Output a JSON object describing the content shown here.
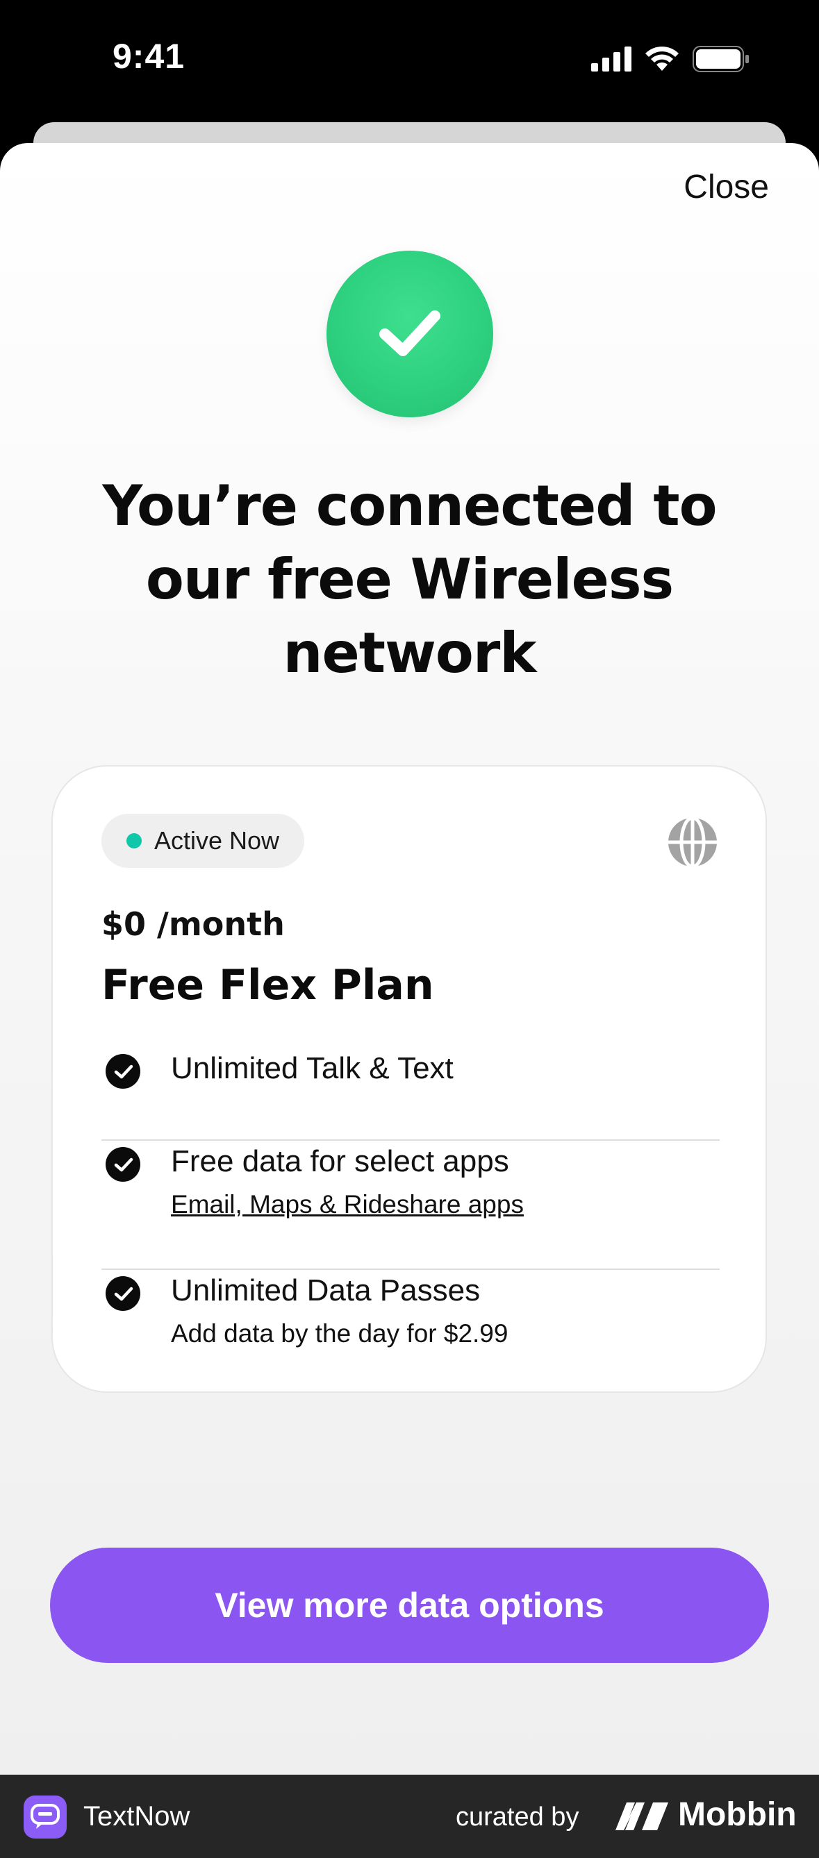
{
  "status_bar": {
    "time": "9:41"
  },
  "modal": {
    "close_label": "Close",
    "headline": "You’re connected to our free Wireless network",
    "success_icon": "check-icon",
    "success_color": "#2ccf7e"
  },
  "plan_card": {
    "status_label": "Active Now",
    "status_color": "#10c7a9",
    "globe_icon": "globe-icon",
    "price": "$0 /month",
    "plan_name": "Free Flex Plan",
    "features": [
      {
        "title": "Unlimited Talk & Text"
      },
      {
        "title": "Free data for select apps",
        "subtitle": "Email, Maps & Rideshare apps"
      },
      {
        "title": "Unlimited Data Passes",
        "subtitle": "Add data by the day for $2.99"
      }
    ]
  },
  "cta": {
    "label": "View more data options",
    "color": "#8a55f0"
  },
  "footer": {
    "app_name": "TextNow",
    "curated_label": "curated by",
    "brand": "Mobbin"
  }
}
